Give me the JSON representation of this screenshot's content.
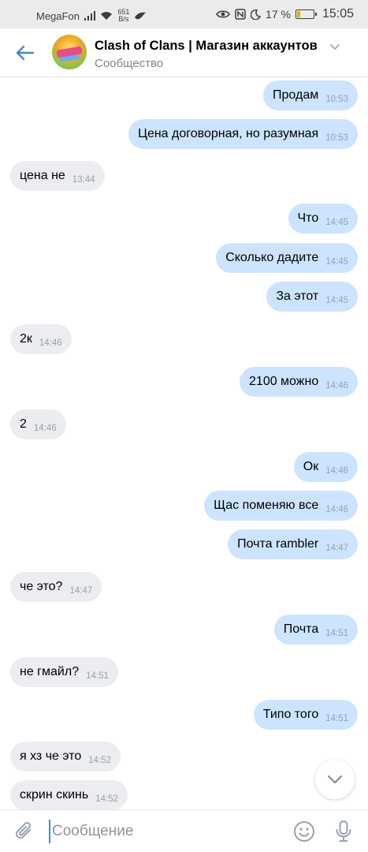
{
  "status_bar": {
    "carrier": "MegaFon",
    "speed_value": "651",
    "speed_unit": "B/s",
    "battery": "17 %",
    "time": "15:05"
  },
  "header": {
    "title": "Clash of Clans | Магазин аккаунтов",
    "subtitle": "Сообщество"
  },
  "messages": [
    {
      "dir": "out",
      "text": "Продам",
      "time": "10:53"
    },
    {
      "dir": "out",
      "text": "Цена договорная, но разумная",
      "time": "10:53"
    },
    {
      "dir": "in",
      "text": "цена не",
      "time": "13:44"
    },
    {
      "dir": "out",
      "text": "Что",
      "time": "14:45"
    },
    {
      "dir": "out",
      "text": "Сколько дадите",
      "time": "14:45"
    },
    {
      "dir": "out",
      "text": "За этот",
      "time": "14:45"
    },
    {
      "dir": "in",
      "text": "2к",
      "time": "14:46"
    },
    {
      "dir": "out",
      "text": "2100 можно",
      "time": "14:46"
    },
    {
      "dir": "in",
      "text": "2",
      "time": "14:46"
    },
    {
      "dir": "out",
      "text": "Ок",
      "time": "14:46"
    },
    {
      "dir": "out",
      "text": "Щас поменяю все",
      "time": "14:46"
    },
    {
      "dir": "out",
      "text": "Почта rambler",
      "time": "14:47"
    },
    {
      "dir": "in",
      "text": "че это?",
      "time": "14:47"
    },
    {
      "dir": "out",
      "text": "Почта",
      "time": "14:51"
    },
    {
      "dir": "in",
      "text": "не гмайл?",
      "time": "14:51"
    },
    {
      "dir": "out",
      "text": "Типо того",
      "time": "14:51"
    },
    {
      "dir": "in",
      "text": "я хз че это",
      "time": "14:52"
    },
    {
      "dir": "in",
      "text": "скрин скинь",
      "time": "14:52"
    }
  ],
  "composer": {
    "placeholder": "Сообщение"
  },
  "colors": {
    "outgoing_bubble": "#cce4ff",
    "incoming_bubble": "#ebedf0",
    "accent": "#4986cc"
  }
}
